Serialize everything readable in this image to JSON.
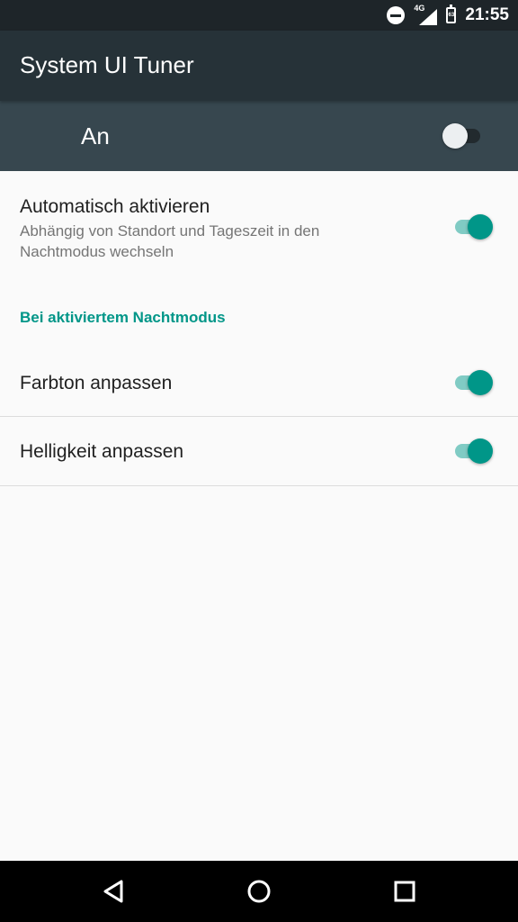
{
  "status_bar": {
    "network_type": "4G",
    "battery_level": "63",
    "time": "21:55",
    "icons": [
      "do-not-disturb-icon",
      "signal-icon",
      "battery-icon"
    ]
  },
  "app_bar": {
    "title": "System UI Tuner"
  },
  "master_switch": {
    "label": "An",
    "checked": false
  },
  "settings": {
    "auto_activate": {
      "title": "Automatisch aktivieren",
      "summary": "Abhängig von Standort und Tageszeit in den Nachtmodus wechseln",
      "checked": true
    },
    "section_header": "Bei aktiviertem Nachtmodus",
    "adjust_tint": {
      "title": "Farbton anpassen",
      "checked": true
    },
    "adjust_brightness": {
      "title": "Helligkeit anpassen",
      "checked": true
    }
  },
  "nav_bar": {
    "icons": [
      "back-icon",
      "home-icon",
      "recents-icon"
    ]
  },
  "colors": {
    "accent": "#009688",
    "accent_track": "#80cbc4",
    "app_bar": "#263238",
    "master_bar": "#37474f",
    "status_bar": "#1e2529",
    "background": "#fafafa"
  }
}
